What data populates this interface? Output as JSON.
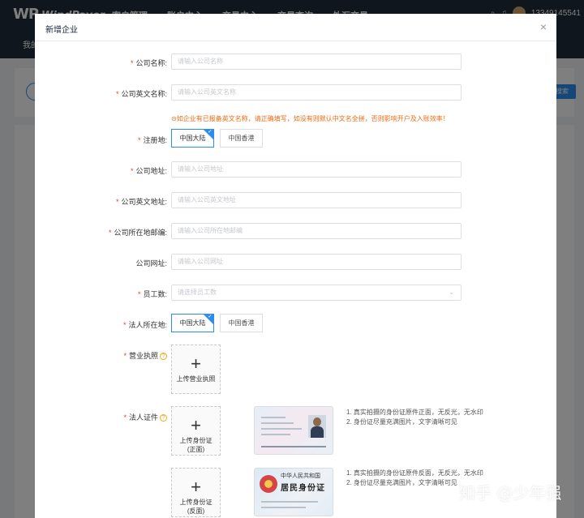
{
  "app": {
    "logo_main": "WP",
    "logo_sub": "WindPayer",
    "nav": [
      "客户管理",
      "账户中心",
      "交易中心",
      "交易查询",
      "外汇交易"
    ],
    "user_phone": "13349145541",
    "subnav": "我的",
    "bg_button": "搜索"
  },
  "modal": {
    "title": "新增企业",
    "close": "×"
  },
  "form": {
    "company_name": {
      "label": "公司名称:",
      "placeholder": "请输入公司名称"
    },
    "company_en_name": {
      "label": "公司英文名称:",
      "placeholder": "请输入公司英文名称"
    },
    "en_name_hint": "⊙如企业有已报备英文名称，请正确填写，如没有则默认中文名全拼，否则影响开户及入账效率！",
    "register_place": {
      "label": "注册地:",
      "options": [
        "中国大陆",
        "中国香港"
      ],
      "selected": "中国大陆"
    },
    "company_address": {
      "label": "公司地址:",
      "placeholder": "请输入公司地址"
    },
    "company_en_address": {
      "label": "公司英文地址:",
      "placeholder": "请输入公司英文地址"
    },
    "company_postcode": {
      "label": "公司所在地邮编:",
      "placeholder": "请输入公司所在地邮编"
    },
    "company_website": {
      "label": "公司网址:",
      "placeholder": "请输入公司网址"
    },
    "employees": {
      "label": "员工数:",
      "placeholder": "请选择员工数"
    },
    "legal_place": {
      "label": "法人所在地:",
      "options": [
        "中国大陆",
        "中国香港"
      ],
      "selected": "中国大陆"
    },
    "business_license": {
      "label": "营业执照",
      "upload_text": "上传营业执照"
    },
    "legal_id": {
      "label": "法人证件",
      "front_upload": "上传身份证\n(正面)",
      "back_upload": "上传身份证\n(反面)",
      "front_notes": [
        "1. 真实拍摄的身份证原件正面，无反光，无水印",
        "2. 身份证尽量充满图片，文字清晰可见"
      ],
      "back_notes": [
        "1. 真实拍摄的身份证原件反面，无反光，无水印",
        "2. 身份证尽量充满图片，文字清晰可见"
      ],
      "back_card_title": "中华人民共和国",
      "back_card_big": "居民身份证"
    }
  },
  "watermark": "知乎 @少年强"
}
